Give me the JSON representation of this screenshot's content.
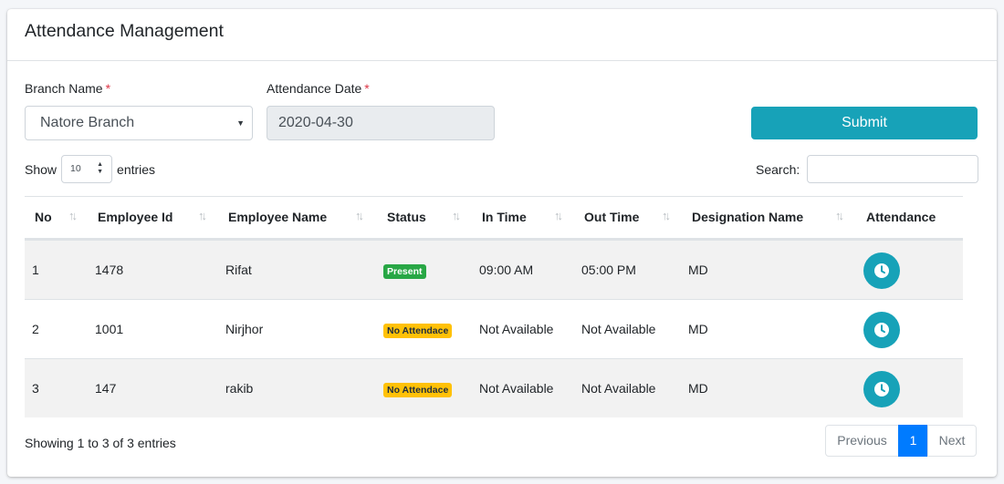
{
  "header": {
    "title": "Attendance Management"
  },
  "form": {
    "branch_label": "Branch Name",
    "date_label": "Attendance Date",
    "required_mark": "*",
    "branch_value": "Natore Branch",
    "date_value": "2020-04-30",
    "submit_label": "Submit"
  },
  "table_controls": {
    "show_label": "Show",
    "length_value": "10",
    "entries_label": "entries",
    "search_label": "Search:"
  },
  "table": {
    "columns": [
      "No",
      "Employee Id",
      "Employee Name",
      "Status",
      "In Time",
      "Out Time",
      "Designation Name",
      "Attendance"
    ],
    "rows": [
      {
        "no": "1",
        "employee_id": "1478",
        "name": "Rifat",
        "status": "Present",
        "in_time": "09:00 AM",
        "out_time": "05:00 PM",
        "designation": "MD"
      },
      {
        "no": "2",
        "employee_id": "1001",
        "name": "Nirjhor",
        "status": "No Attendace",
        "in_time": "Not Available",
        "out_time": "Not Available",
        "designation": "MD"
      },
      {
        "no": "3",
        "employee_id": "147",
        "name": "rakib",
        "status": "No Attendace",
        "in_time": "Not Available",
        "out_time": "Not Available",
        "designation": "MD"
      }
    ]
  },
  "footer": {
    "info": "Showing 1 to 3 of 3 entries",
    "previous_label": "Previous",
    "current_page": "1",
    "next_label": "Next"
  },
  "colors": {
    "accent": "#17a2b8",
    "present": "#28a745",
    "no_attendance": "#ffc107",
    "active_page": "#007bff",
    "required": "#dc3545"
  },
  "icons": {
    "attendance_action": "clock-icon",
    "sort": "sort-icon",
    "dropdown": "caret-down-icon"
  }
}
